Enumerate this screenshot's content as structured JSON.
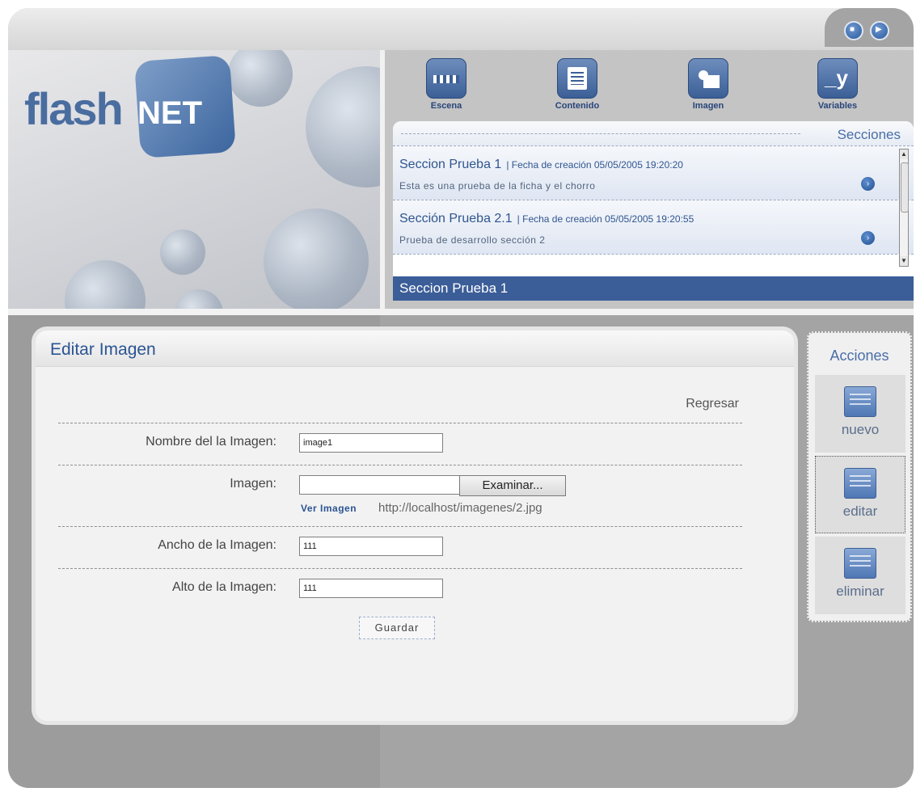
{
  "logo": {
    "flash": "flash",
    "net": "NET"
  },
  "nav": [
    {
      "label": "Escena",
      "icon": "clapper-icon"
    },
    {
      "label": "Contenido",
      "icon": "document-icon"
    },
    {
      "label": "Imagen",
      "icon": "image-icon"
    },
    {
      "label": "Variables",
      "icon": "variable-icon",
      "glyph": "_y"
    }
  ],
  "sections": {
    "title": "Secciones",
    "items": [
      {
        "name": "Seccion Prueba 1",
        "date": "| Fecha de creación 05/05/2005 19:20:20",
        "desc": "Esta es una prueba de la ficha y el chorro"
      },
      {
        "name": "Sección Prueba 2.1",
        "date": "| Fecha de creación 05/05/2005 19:20:55",
        "desc": "Prueba de desarrollo sección 2"
      }
    ],
    "selected": "Seccion Prueba 1"
  },
  "editor": {
    "title": "Editar Imagen",
    "back": "Regresar",
    "name_label": "Nombre del la Imagen:",
    "name_value": "image1",
    "image_label": "Imagen:",
    "file_value": "",
    "browse": "Examinar...",
    "view_image": "Ver Imagen",
    "image_url": "http://localhost/imagenes/2.jpg",
    "width_label": "Ancho de la Imagen:",
    "width_value": "111",
    "height_label": "Alto de la Imagen:",
    "height_value": "111",
    "save": "Guardar"
  },
  "actions": {
    "title": "Acciones",
    "new": "nuevo",
    "edit": "editar",
    "delete": "eliminar"
  },
  "colors": {
    "accent": "#2b5493",
    "selected_bar": "#3b5d98",
    "frame": "#a4a4a4"
  }
}
